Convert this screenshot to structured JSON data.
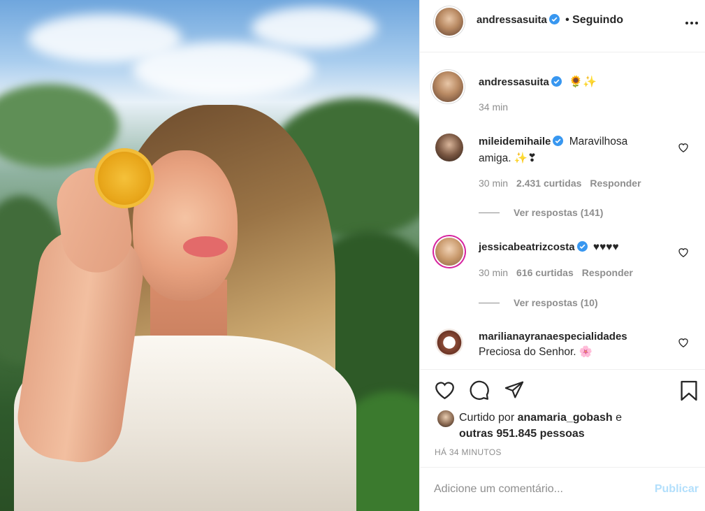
{
  "post": {
    "author": {
      "username": "andressasuita",
      "follow_status": "• Seguindo"
    },
    "caption": {
      "username": "andressasuita",
      "emojis": "🌻✨",
      "time": "34 min"
    },
    "comments": [
      {
        "username": "mileidemihaile",
        "text_line1": "Maravilhosa",
        "text_line2": "amiga. ✨❣",
        "time": "30 min",
        "likes": "2.431 curtidas",
        "reply": "Responder",
        "view_replies": "Ver respostas (141)"
      },
      {
        "username": "jessicabeatrizcosta",
        "text": "♥♥♥♥",
        "time": "30 min",
        "likes": "616 curtidas",
        "reply": "Responder",
        "view_replies": "Ver respostas (10)"
      },
      {
        "username": "marilianayranaespecialidades",
        "text": "Preciosa do Senhor. 🌸"
      }
    ],
    "likes": {
      "prefix": "Curtido por ",
      "user": "anamaria_gobash",
      "mid": " e",
      "others": "outras 951.845 pessoas"
    },
    "date": "HÁ 34 MINUTOS",
    "add_comment": {
      "placeholder": "Adicione um comentário...",
      "publish": "Publicar"
    },
    "colors": {
      "verified": "#3897f0",
      "publish_disabled": "#b2dffc",
      "muted": "#8e8e8e"
    },
    "icons": [
      "more-options-icon",
      "heart-icon",
      "comment-icon",
      "share-icon",
      "bookmark-icon",
      "verified-badge-icon"
    ]
  }
}
